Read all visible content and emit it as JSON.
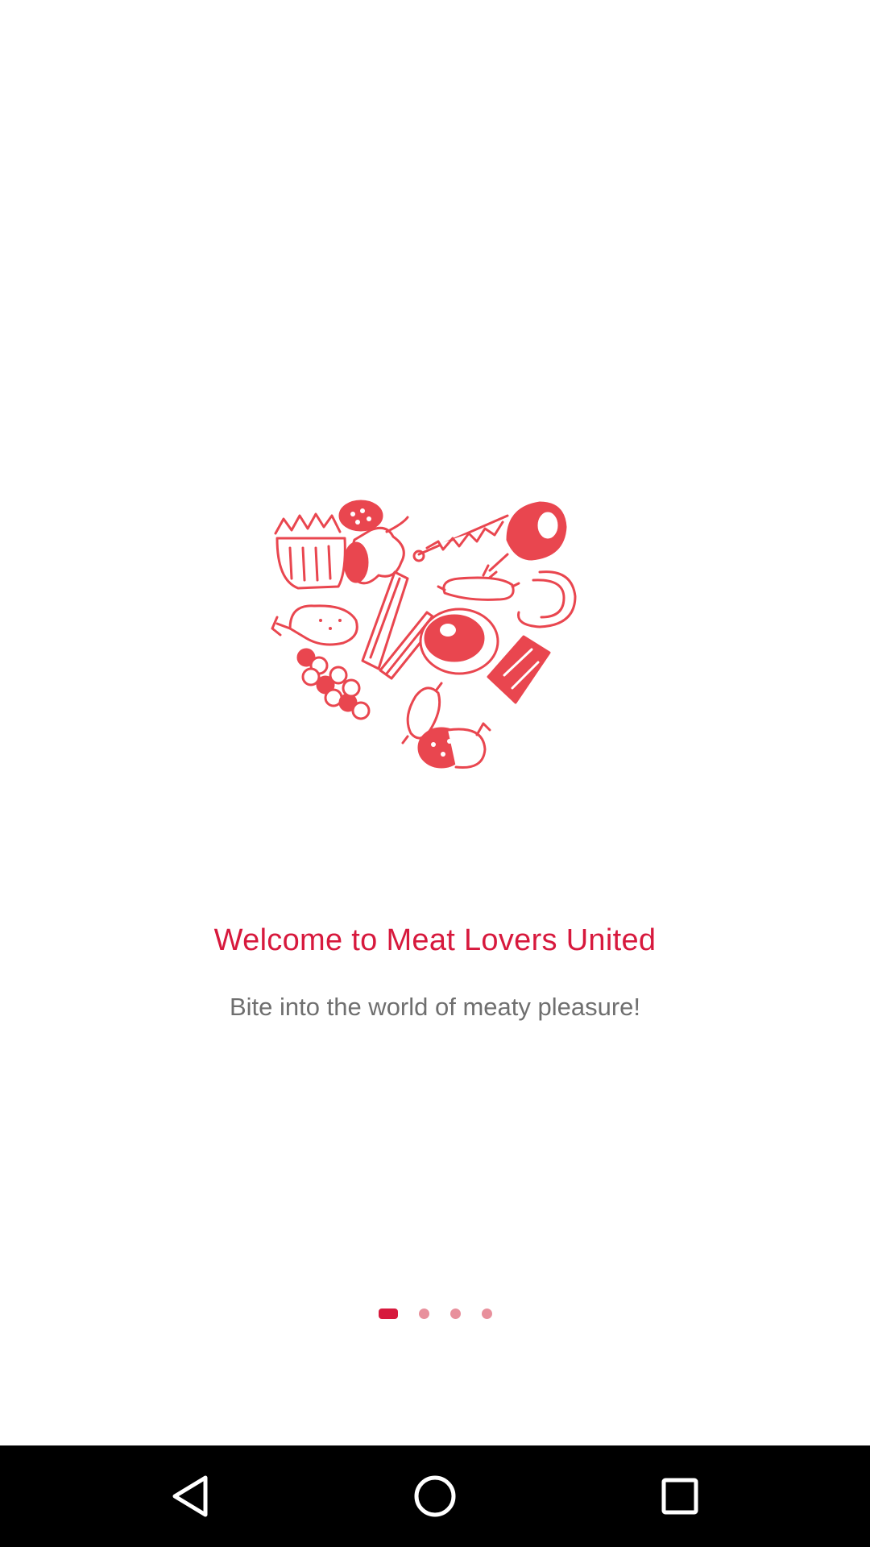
{
  "onboarding": {
    "title": "Welcome to Meat Lovers United",
    "subtitle": "Bite into the world of meaty pleasure!",
    "illustration_icon": "meat-heart-illustration",
    "pager": {
      "count": 4,
      "active_index": 0
    }
  },
  "colors": {
    "accent": "#d7193d",
    "illustration": "#e9464f",
    "subtitle": "#6f6f6f",
    "dot_inactive": "#e8909c",
    "navbar_bg": "#000000",
    "nav_icon": "#ffffff"
  },
  "navbar": {
    "back_icon": "back-triangle-icon",
    "home_icon": "home-circle-icon",
    "recents_icon": "recents-square-icon"
  }
}
